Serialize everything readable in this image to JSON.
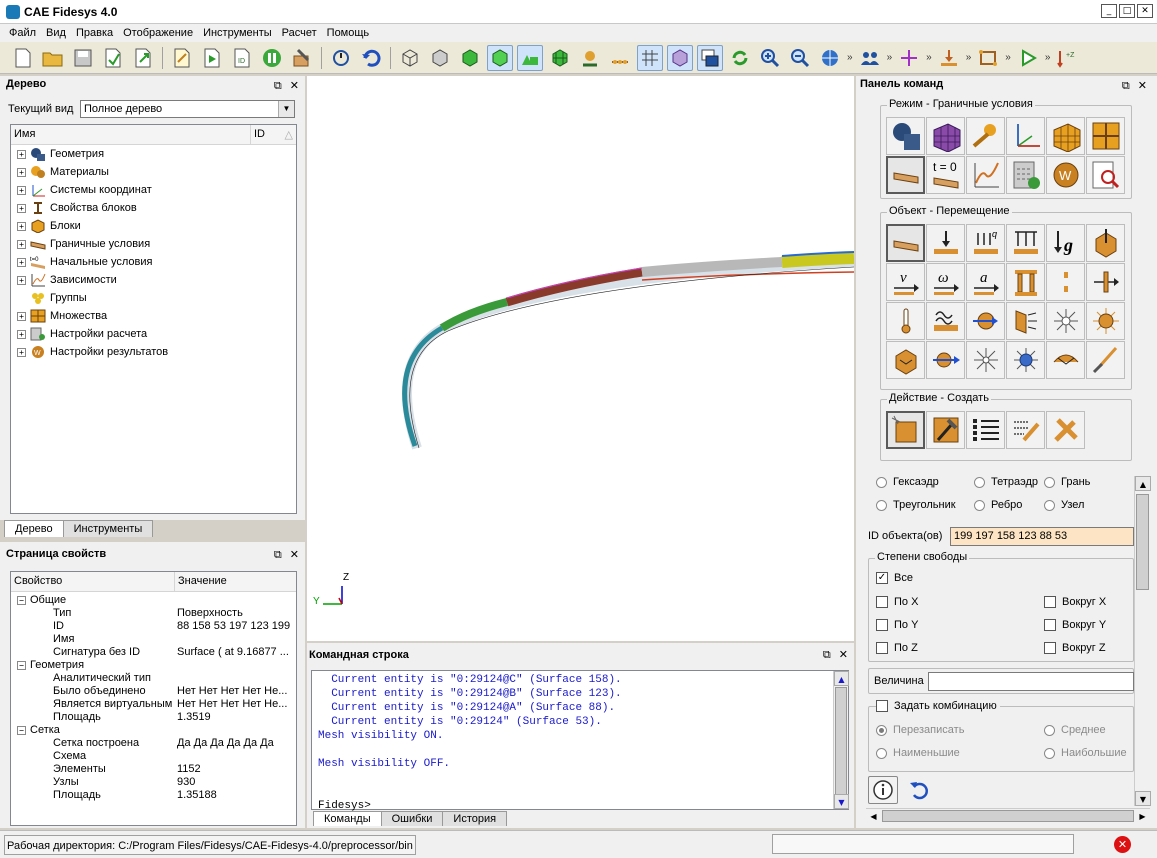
{
  "app": {
    "title": "CAE Fidesys 4.0"
  },
  "window_buttons": {
    "minimize": "_",
    "maximize": "□",
    "close": "✕"
  },
  "menu": [
    "Файл",
    "Вид",
    "Правка",
    "Отображение",
    "Инструменты",
    "Расчет",
    "Помощь"
  ],
  "tree_panel": {
    "title": "Дерево",
    "view_label": "Текущий вид",
    "view_value": "Полное дерево",
    "col_name": "Имя",
    "col_id": "ID",
    "items": [
      {
        "label": "Геометрия",
        "icon": "geometry-icon",
        "expandable": true
      },
      {
        "label": "Материалы",
        "icon": "materials-icon",
        "expandable": true
      },
      {
        "label": "Системы координат",
        "icon": "coordinate-systems-icon",
        "expandable": true
      },
      {
        "label": "Свойства блоков",
        "icon": "block-properties-icon",
        "expandable": true
      },
      {
        "label": "Блоки",
        "icon": "blocks-icon",
        "expandable": true
      },
      {
        "label": "Граничные условия",
        "icon": "boundary-conditions-icon",
        "expandable": true
      },
      {
        "label": "Начальные условия",
        "icon": "initial-conditions-icon",
        "expandable": true
      },
      {
        "label": "Зависимости",
        "icon": "dependencies-icon",
        "expandable": true
      },
      {
        "label": "Группы",
        "icon": "groups-icon",
        "expandable": false
      },
      {
        "label": "Множества",
        "icon": "sets-icon",
        "expandable": true
      },
      {
        "label": "Настройки расчета",
        "icon": "calc-settings-icon",
        "expandable": true
      },
      {
        "label": "Настройки результатов",
        "icon": "results-settings-icon",
        "expandable": true
      }
    ],
    "tabs": [
      "Дерево",
      "Инструменты"
    ]
  },
  "prop_panel": {
    "title": "Страница свойств",
    "col_prop": "Свойство",
    "col_value": "Значение",
    "rows": [
      {
        "k": "Общие",
        "v": "",
        "level": 0,
        "group": true
      },
      {
        "k": "Тип",
        "v": "Поверхность",
        "level": 1
      },
      {
        "k": "ID",
        "v": "88 158 53 197 123 199",
        "level": 1
      },
      {
        "k": "Имя",
        "v": "",
        "level": 1
      },
      {
        "k": "Сигнатура без ID",
        "v": "Surface ( at 9.16877 ...",
        "level": 1
      },
      {
        "k": "Геометрия",
        "v": "",
        "level": 0,
        "group": true
      },
      {
        "k": "Аналитический тип",
        "v": "",
        "level": 1
      },
      {
        "k": "Было объединено",
        "v": "Нет Нет Нет Нет Не...",
        "level": 1
      },
      {
        "k": "Является виртуальным",
        "v": "Нет Нет Нет Нет Не...",
        "level": 1
      },
      {
        "k": "Площадь",
        "v": "1.3519",
        "level": 1
      },
      {
        "k": "Сетка",
        "v": "",
        "level": 0,
        "group": true
      },
      {
        "k": "Сетка построена",
        "v": "Да Да Да Да Да Да",
        "level": 1
      },
      {
        "k": "Схема",
        "v": "",
        "level": 1
      },
      {
        "k": "Элементы",
        "v": "1152",
        "level": 1
      },
      {
        "k": "Узлы",
        "v": "930",
        "level": 1
      },
      {
        "k": "Площадь",
        "v": "1.35188",
        "level": 1
      }
    ]
  },
  "viewport": {
    "axis_z": "Z",
    "axis_y": "Y"
  },
  "cmd_panel": {
    "title": "Командная строка",
    "lines": [
      "  Current entity is \"0:29124@C\" (Surface 158).",
      "  Current entity is \"0:29124@B\" (Surface 123).",
      "  Current entity is \"0:29124@A\" (Surface 88).",
      "  Current entity is \"0:29124\" (Surface 53).",
      "Mesh visibility ON.",
      "",
      "Mesh visibility OFF.",
      "",
      "",
      "Fidesys>"
    ],
    "tabs": [
      "Команды",
      "Ошибки",
      "История"
    ]
  },
  "right_panel": {
    "title": "Панель команд",
    "mode_group": "Режим - Граничные условия",
    "object_group": "Объект - Перемещение",
    "action_group": "Действие - Создать",
    "t0_label": "t = 0",
    "entity_types": [
      "Гексаэдр",
      "Тетраэдр",
      "Грань",
      "Треугольник",
      "Ребро",
      "Узел"
    ],
    "id_label": "ID объекта(ов)",
    "id_value": "199 197 158 123 88 53",
    "dof_title": "Степени свободы",
    "dof_all": "Все",
    "dof": [
      "По X",
      "Вокруг X",
      "По Y",
      "Вокруг Y",
      "По Z",
      "Вокруг Z"
    ],
    "magnitude_label": "Величина",
    "magnitude_value": "",
    "combo_label": "Задать комбинацию",
    "combo_opts": [
      "Перезаписать",
      "Среднее",
      "Наименьшие",
      "Наибольшие"
    ]
  },
  "status": {
    "workdir": "Рабочая директория: C:/Program Files/Fidesys/CAE-Fidesys-4.0/preprocessor/bin",
    "stop_label": "✕"
  },
  "colors": {
    "accent": "#d9862a",
    "cmd_text": "#1a1acc"
  }
}
